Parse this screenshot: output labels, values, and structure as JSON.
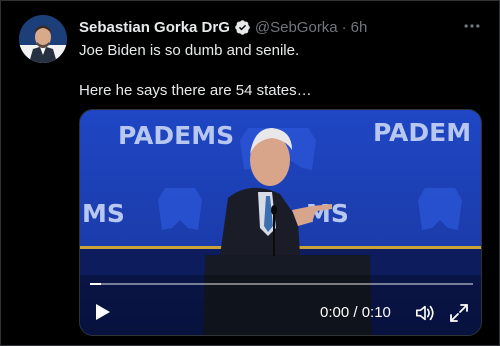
{
  "tweet": {
    "author": {
      "display_name": "Sebastian Gorka DrG",
      "handle": "@SebGorka",
      "verified": true
    },
    "timestamp": "6h",
    "separator": "·",
    "text_lines": [
      "Joe Biden is so dumb and senile.",
      "Here he says there are 54 states…"
    ]
  },
  "video": {
    "current_time": "0:00",
    "duration": "0:10",
    "time_display": "0:00 / 0:10",
    "progress": 0.03,
    "banner_text": "PADEMS",
    "banner_partial_left": "MS",
    "banner_partial_right": "PADEM",
    "banner_partial_center": "MS"
  },
  "icons": {
    "more": "more-icon",
    "verified": "verified-badge-icon",
    "play": "play-icon",
    "volume": "volume-icon",
    "fullscreen": "fullscreen-icon"
  },
  "colors": {
    "background": "#000000",
    "primary_text": "#e7e9ea",
    "secondary_text": "#71767b",
    "verified_blue": "#1d9bf0",
    "stage_blue": "#1a3db0"
  }
}
